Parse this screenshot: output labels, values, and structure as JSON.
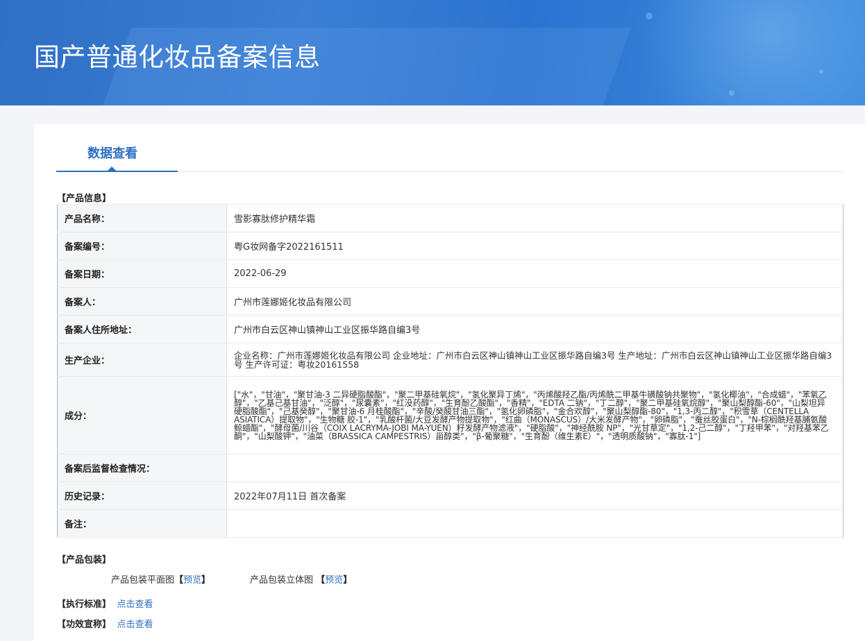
{
  "banner": {
    "title": "国产普通化妆品备案信息"
  },
  "tab": {
    "label": "数据查看"
  },
  "sections": {
    "product_info": "【产品信息】",
    "product_package": "【产品包装】",
    "exec_standard": "【执行标准】",
    "efficacy_claim": "【功效宣称】"
  },
  "product_info": {
    "rows": [
      {
        "label": "产品名称：",
        "value": "雪影寡肽修护精华霜"
      },
      {
        "label": "备案编号：",
        "value": "粤G妆网备字2022161511"
      },
      {
        "label": "备案日期：",
        "value": "2022-06-29"
      },
      {
        "label": "备案人：",
        "value": "广州市莲娜姬化妆品有限公司"
      },
      {
        "label": "备案人住所地址：",
        "value": "广州市白云区神山镇神山工业区振华路自编3号"
      },
      {
        "label": "生产企业：",
        "value": "企业名称：广州市莲娜姬化妆品有限公司 企业地址：广州市白云区神山镇神山工业区振华路自编3号 生产地址：广州市白云区神山镇神山工业区振华路自编3号 生产许可证：粤妆20161558"
      },
      {
        "label": "成分：",
        "value": "[\"水\"，\"甘油\"，\"聚甘油-3 二异硬脂酸酯\"，\"聚二甲基硅氧烷\"，\"氢化聚异丁烯\"，\"丙烯酸羟乙酯/丙烯酰二甲基牛磺酸钠共聚物\"，\"氢化椰油\"，\"合成蜡\"，\"苯氧乙醇\"，\"乙基己基甘油\"，\"泛醇\"，\"尿囊素\"，\"红没药醇\"，\"生育酚乙酸酯\"，\"香精\"，\"EDTA 二钠\"，\"丁二醇\"，\"聚二甲基硅氧烷醇\"，\"聚山梨醇酯-60\"，\"山梨坦异硬脂酸酯\"，\"己基癸醇\"，\"聚甘油-6 月桂酸酯\"，\"辛酸/癸酸甘油三酯\"，\"氢化卵磷脂\"，\"金合欢醇\"，\"聚山梨醇酯-80\"，\"1,3-丙二醇\"，\"积雪草（CENTELLA ASIATICA）提取物\"，\"生物糖 胶-1\"，\"乳酸杆菌/大豆发酵产物提取物\"，\"红曲（MONASCUS）/大米发酵产物\"，\"卵磷脂\"，\"蚕丝胶蛋白\"，\"N-棕榈酰羟基脯氨酸鲸蜡酯\"，\"酵母菌/川谷（COIX LACRYMA-JOBI MA-YUEN）籽发酵产物滤液\"，\"硬脂酸\"，\"神经酰胺 NP\"，\"光甘草定\"，\"1,2-己二醇\"，\"丁羟甲苯\"，\"对羟基苯乙酮\"，\"山梨酸钾\"，\"油菜（BRASSICA CAMPESTRIS）甾醇类\"，\"β-葡聚糖\"，\"生育酚（维生素E）\"，\"透明质酸钠\"，\"寡肽-1\"]"
      },
      {
        "label": "备案后监督检查情况：",
        "value": ""
      },
      {
        "label": "历史记录：",
        "value": "2022年07月11日 首次备案"
      },
      {
        "label": "备注：",
        "value": ""
      }
    ]
  },
  "package": {
    "flat_label": "产品包装平面图",
    "solid_label": "产品包装立体图",
    "bracket_open": "【",
    "bracket_close": "】",
    "preview_link": "预览"
  },
  "links": {
    "view": "点击查看"
  }
}
